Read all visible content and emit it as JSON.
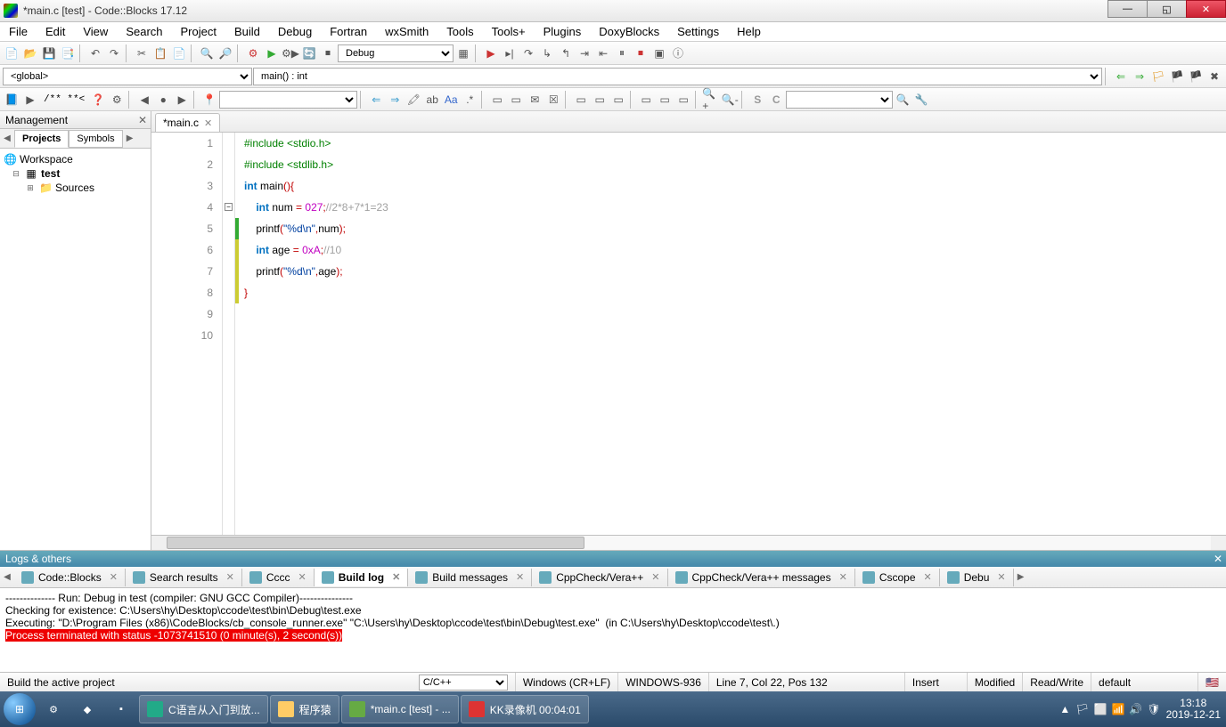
{
  "window": {
    "title": "*main.c [test] - Code::Blocks 17.12"
  },
  "menu": [
    "File",
    "Edit",
    "View",
    "Search",
    "Project",
    "Build",
    "Debug",
    "Fortran",
    "wxSmith",
    "Tools",
    "Tools+",
    "Plugins",
    "DoxyBlocks",
    "Settings",
    "Help"
  ],
  "toolbar": {
    "buildTarget": "Debug",
    "scope": "<global>",
    "func": "main() : int",
    "jump": "/** **<"
  },
  "sidebar": {
    "title": "Management",
    "tabs": [
      "Projects",
      "Symbols"
    ],
    "tree": {
      "workspace": "Workspace",
      "project": "test",
      "folder": "Sources"
    }
  },
  "editor": {
    "tab": "*main.c",
    "code": [
      {
        "n": 1,
        "ch": "",
        "seg": [
          {
            "t": "#include ",
            "c": "pp"
          },
          {
            "t": "<stdio.h>",
            "c": "pp"
          }
        ]
      },
      {
        "n": 2,
        "ch": "",
        "seg": [
          {
            "t": "#include ",
            "c": "pp"
          },
          {
            "t": "<stdlib.h>",
            "c": "pp"
          }
        ]
      },
      {
        "n": 3,
        "ch": "",
        "seg": [
          {
            "t": "",
            "c": ""
          }
        ]
      },
      {
        "n": 4,
        "ch": "",
        "seg": [
          {
            "t": "int",
            "c": "k"
          },
          {
            "t": " main",
            "c": "fn"
          },
          {
            "t": "(){",
            "c": "op"
          }
        ]
      },
      {
        "n": 5,
        "ch": "g",
        "seg": [
          {
            "t": "    ",
            "c": ""
          },
          {
            "t": "int",
            "c": "k"
          },
          {
            "t": " num ",
            "c": ""
          },
          {
            "t": "=",
            "c": "op"
          },
          {
            "t": " ",
            "c": ""
          },
          {
            "t": "027",
            "c": "n1"
          },
          {
            "t": ";",
            "c": "op"
          },
          {
            "t": "//2*8+7*1=23",
            "c": "cm"
          }
        ]
      },
      {
        "n": 6,
        "ch": "y",
        "seg": [
          {
            "t": "    printf",
            "c": ""
          },
          {
            "t": "(",
            "c": "op"
          },
          {
            "t": "\"%d\\n\"",
            "c": "s"
          },
          {
            "t": ",",
            "c": "op"
          },
          {
            "t": "num",
            "c": ""
          },
          {
            "t": ");",
            "c": "op"
          }
        ]
      },
      {
        "n": 7,
        "ch": "y",
        "seg": [
          {
            "t": "    ",
            "c": ""
          },
          {
            "t": "int",
            "c": "k"
          },
          {
            "t": " age ",
            "c": ""
          },
          {
            "t": "=",
            "c": "op"
          },
          {
            "t": " ",
            "c": ""
          },
          {
            "t": "0xA",
            "c": "n1"
          },
          {
            "t": ";",
            "c": "op"
          },
          {
            "t": "//10",
            "c": "cm"
          }
        ]
      },
      {
        "n": 8,
        "ch": "y",
        "seg": [
          {
            "t": "    printf",
            "c": ""
          },
          {
            "t": "(",
            "c": "op"
          },
          {
            "t": "\"%d\\n\"",
            "c": "s"
          },
          {
            "t": ",",
            "c": "op"
          },
          {
            "t": "age",
            "c": ""
          },
          {
            "t": ");",
            "c": "op"
          }
        ]
      },
      {
        "n": 9,
        "ch": "",
        "seg": [
          {
            "t": "}",
            "c": "op"
          }
        ]
      },
      {
        "n": 10,
        "ch": "",
        "seg": [
          {
            "t": "",
            "c": ""
          }
        ]
      }
    ]
  },
  "logs": {
    "title": "Logs & others",
    "tabs": [
      "Code::Blocks",
      "Search results",
      "Cccc",
      "Build log",
      "Build messages",
      "CppCheck/Vera++",
      "CppCheck/Vera++ messages",
      "Cscope",
      "Debu"
    ],
    "activeTab": "Build log",
    "lines": [
      {
        "text": "-------------- Run: Debug in test (compiler: GNU GCC Compiler)---------------",
        "red": false
      },
      {
        "text": "",
        "red": false
      },
      {
        "text": "Checking for existence: C:\\Users\\hy\\Desktop\\ccode\\test\\bin\\Debug\\test.exe",
        "red": false
      },
      {
        "text": "Executing: \"D:\\Program Files (x86)\\CodeBlocks/cb_console_runner.exe\" \"C:\\Users\\hy\\Desktop\\ccode\\test\\bin\\Debug\\test.exe\"  (in C:\\Users\\hy\\Desktop\\ccode\\test\\.)",
        "red": false
      },
      {
        "text": "Process terminated with status -1073741510 (0 minute(s), 2 second(s))",
        "red": true
      }
    ]
  },
  "status": {
    "hint": "Build the active project",
    "lang": "C/C++",
    "eol": "Windows (CR+LF)",
    "encoding": "WINDOWS-936",
    "pos": "Line 7, Col 22, Pos 132",
    "insert": "Insert",
    "modified": "Modified",
    "rw": "Read/Write",
    "profile": "default"
  },
  "taskbar": {
    "items": [
      {
        "label": "C语言从入门到放...",
        "color": "#2a8"
      },
      {
        "label": "程序猿",
        "color": "#fc6"
      },
      {
        "label": "*main.c [test] - ...",
        "color": "#6a4"
      },
      {
        "label": "KK录像机 00:04:01",
        "color": "#d33"
      }
    ],
    "time": "13:18",
    "date": "2019-12-21"
  }
}
